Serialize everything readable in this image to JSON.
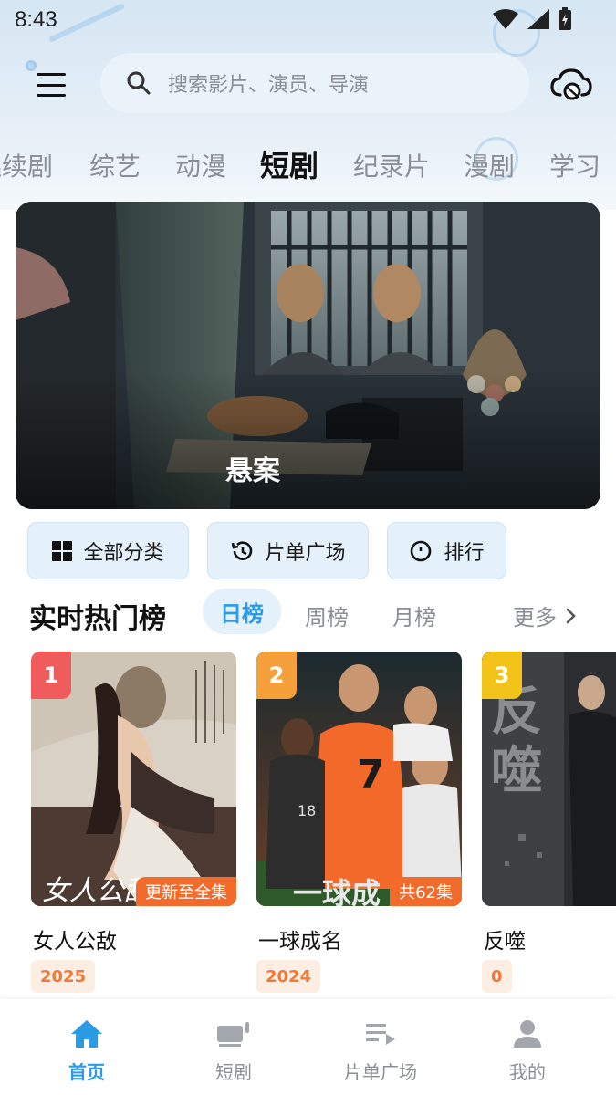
{
  "status_bar": {
    "time": "8:43"
  },
  "search": {
    "placeholder": "搜索影片、演员、导演"
  },
  "category_tabs": [
    {
      "label": "连续剧"
    },
    {
      "label": "综艺"
    },
    {
      "label": "动漫"
    },
    {
      "label": "短剧",
      "active": true
    },
    {
      "label": "纪录片"
    },
    {
      "label": "漫剧"
    },
    {
      "label": "学习"
    }
  ],
  "banner": {
    "title": "悬案"
  },
  "quick_actions": [
    {
      "label": "全部分类",
      "icon": "grid-icon"
    },
    {
      "label": "片单广场",
      "icon": "history-icon"
    },
    {
      "label": "排行",
      "icon": "circle-icon"
    }
  ],
  "rank": {
    "title": "实时热门榜",
    "tabs": [
      {
        "label": "日榜",
        "active": true
      },
      {
        "label": "周榜"
      },
      {
        "label": "月榜"
      }
    ],
    "more": "更多"
  },
  "cards": [
    {
      "rank": "1",
      "title": "女人公敌",
      "tag": "更新至全集",
      "year": "2025",
      "badge_color": "#f05b5b"
    },
    {
      "rank": "2",
      "title": "一球成名",
      "tag": "共62集",
      "year": "2024",
      "badge_color": "#f5a03a"
    },
    {
      "rank": "3",
      "title": "反噬",
      "tag": "",
      "year": "0",
      "badge_color": "#f2c318"
    }
  ],
  "bottom_nav": [
    {
      "label": "首页",
      "icon": "home-icon",
      "active": true
    },
    {
      "label": "短剧",
      "icon": "short-drama-icon"
    },
    {
      "label": "片单广场",
      "icon": "playlist-icon"
    },
    {
      "label": "我的",
      "icon": "user-icon"
    }
  ],
  "colors": {
    "accent": "#2b9be6",
    "tag_orange": "#f26b2a",
    "year_text": "#f07a3a"
  }
}
